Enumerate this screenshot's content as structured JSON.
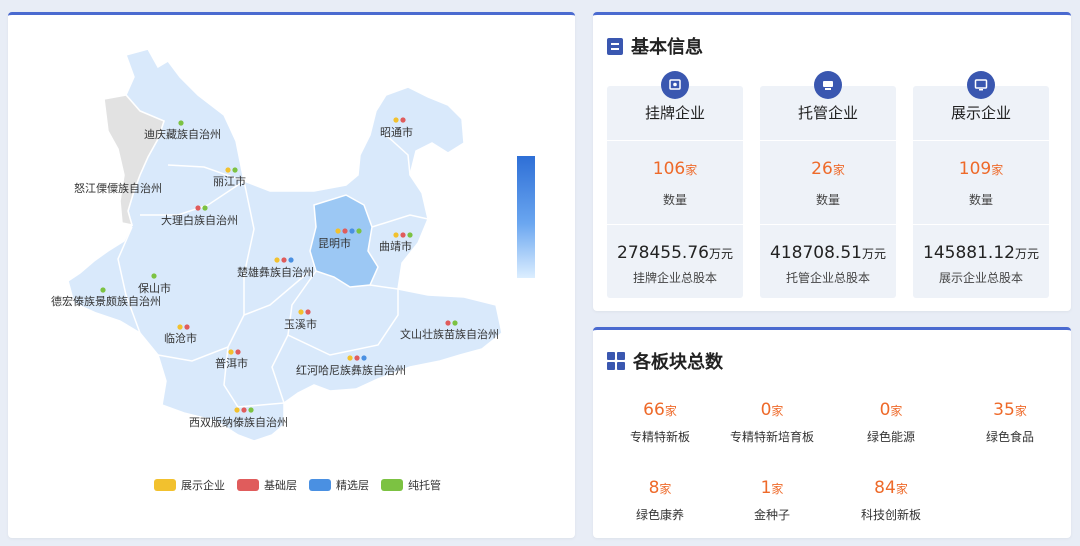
{
  "map": {
    "cities": [
      {
        "id": "diqing",
        "name": "迪庆藏族自治州",
        "dots": [
          "green"
        ]
      },
      {
        "id": "nujiang",
        "name": "怒江傈僳族自治州",
        "dots": []
      },
      {
        "id": "lijiang",
        "name": "丽江市",
        "dots": [
          "yellow",
          "green"
        ]
      },
      {
        "id": "dali",
        "name": "大理白族自治州",
        "dots": [
          "red",
          "green"
        ]
      },
      {
        "id": "baoshan",
        "name": "保山市",
        "dots": [
          "green"
        ]
      },
      {
        "id": "dehong",
        "name": "德宏傣族景颇族自治州",
        "dots": [
          "green"
        ]
      },
      {
        "id": "lincang",
        "name": "临沧市",
        "dots": [
          "yellow",
          "red"
        ]
      },
      {
        "id": "puer",
        "name": "普洱市",
        "dots": [
          "yellow",
          "red"
        ]
      },
      {
        "id": "xishuangbanna",
        "name": "西双版纳傣族自治州",
        "dots": [
          "yellow",
          "red",
          "green"
        ]
      },
      {
        "id": "chuxiong",
        "name": "楚雄彝族自治州",
        "dots": [
          "yellow",
          "red",
          "blue"
        ]
      },
      {
        "id": "kunming",
        "name": "昆明市",
        "dots": [
          "yellow",
          "red",
          "blue",
          "green"
        ]
      },
      {
        "id": "qujing",
        "name": "曲靖市",
        "dots": [
          "yellow",
          "red",
          "green"
        ]
      },
      {
        "id": "zhaotong",
        "name": "昭通市",
        "dots": [
          "yellow",
          "red"
        ]
      },
      {
        "id": "yuxi",
        "name": "玉溪市",
        "dots": [
          "yellow",
          "red"
        ]
      },
      {
        "id": "honghe",
        "name": "红河哈尼族彝族自治州",
        "dots": [
          "yellow",
          "red",
          "blue"
        ]
      },
      {
        "id": "wenshan",
        "name": "文山壮族苗族自治州",
        "dots": [
          "red",
          "green"
        ]
      }
    ],
    "legend": [
      {
        "label": "展示企业",
        "color": "#f2c12e"
      },
      {
        "label": "基础层",
        "color": "#e05c5c"
      },
      {
        "label": "精选层",
        "color": "#4a90e2"
      },
      {
        "label": "纯托管",
        "color": "#7cc242"
      }
    ],
    "dot_colors": {
      "yellow": "#f2c12e",
      "red": "#e05c5c",
      "blue": "#4a90e2",
      "green": "#7cc242"
    }
  },
  "info": {
    "title": "基本信息",
    "cards": [
      {
        "title": "挂牌企业",
        "count": "106",
        "count_unit": "家",
        "count_label": "数量",
        "capital": "278455.76",
        "capital_unit": "万元",
        "capital_label": "挂牌企业总股本",
        "icon": "certificate-icon"
      },
      {
        "title": "托管企业",
        "count": "26",
        "count_unit": "家",
        "count_label": "数量",
        "capital": "418708.51",
        "capital_unit": "万元",
        "capital_label": "托管企业总股本",
        "icon": "custody-icon"
      },
      {
        "title": "展示企业",
        "count": "109",
        "count_unit": "家",
        "count_label": "数量",
        "capital": "145881.12",
        "capital_unit": "万元",
        "capital_label": "展示企业总股本",
        "icon": "monitor-icon"
      }
    ]
  },
  "sectors": {
    "title": "各板块总数",
    "items": [
      {
        "value": "66",
        "unit": "家",
        "label": "专精特新板"
      },
      {
        "value": "0",
        "unit": "家",
        "label": "专精特新培育板"
      },
      {
        "value": "0",
        "unit": "家",
        "label": "绿色能源"
      },
      {
        "value": "35",
        "unit": "家",
        "label": "绿色食品"
      },
      {
        "value": "8",
        "unit": "家",
        "label": "绿色康养"
      },
      {
        "value": "1",
        "unit": "家",
        "label": "金种子"
      },
      {
        "value": "84",
        "unit": "家",
        "label": "科技创新板"
      }
    ]
  }
}
